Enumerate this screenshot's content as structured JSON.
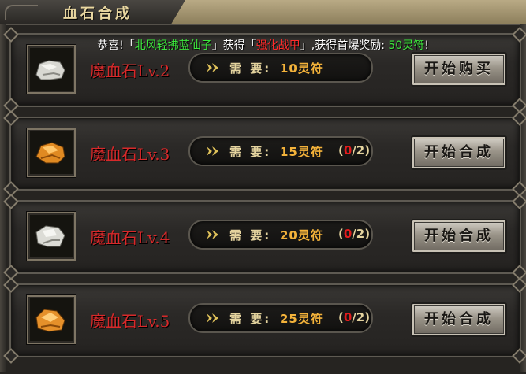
{
  "window": {
    "title": "血石合成"
  },
  "notice": {
    "prefix": "恭喜!「",
    "player": "北风轻拂蓝仙子",
    "mid1": "」获得「",
    "item": "强化战甲",
    "mid2": "」,获得首爆奖励: ",
    "reward": "50灵符",
    "suffix": "!"
  },
  "rows": [
    {
      "name": "魔血石Lv.2",
      "req_label": "需 要:",
      "amount": "10灵符",
      "progress_open": "",
      "have": "",
      "progress_close": "",
      "button": "开始购买",
      "icon_color": "white"
    },
    {
      "name": "魔血石Lv.3",
      "req_label": "需 要:",
      "amount": "15灵符",
      "progress_open": "(",
      "have": "0",
      "progress_close": "/2)",
      "button": "开始合成",
      "icon_color": "orange"
    },
    {
      "name": "魔血石Lv.4",
      "req_label": "需 要:",
      "amount": "20灵符",
      "progress_open": "(",
      "have": "0",
      "progress_close": "/2)",
      "button": "开始合成",
      "icon_color": "white"
    },
    {
      "name": "魔血石Lv.5",
      "req_label": "需 要:",
      "amount": "25灵符",
      "progress_open": "(",
      "have": "0",
      "progress_close": "/2)",
      "button": "开始合成",
      "icon_color": "orange"
    }
  ]
}
